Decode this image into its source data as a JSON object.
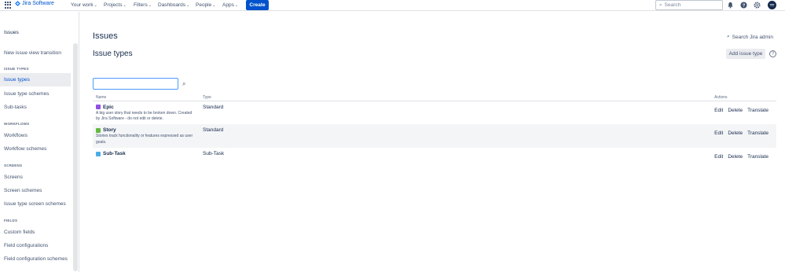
{
  "topnav": {
    "logo_text": "Jira Software",
    "items": [
      {
        "label": "Your work"
      },
      {
        "label": "Projects"
      },
      {
        "label": "Filters"
      },
      {
        "label": "Dashboards"
      },
      {
        "label": "People"
      },
      {
        "label": "Apps"
      }
    ],
    "create_label": "Create",
    "search_placeholder": "Search",
    "avatar_initials": "TT"
  },
  "sidebar": {
    "title": "Issues",
    "items": [
      {
        "label": "New issue view transition"
      },
      {
        "label": "Issue types"
      },
      {
        "label": "Issue type schemes"
      },
      {
        "label": "Sub-tasks"
      },
      {
        "label": "Workflows"
      },
      {
        "label": "Workflow schemes"
      },
      {
        "label": "Screens"
      },
      {
        "label": "Screen schemes"
      },
      {
        "label": "Issue type screen schemes"
      },
      {
        "label": "Custom fields"
      },
      {
        "label": "Field configurations"
      },
      {
        "label": "Field configuration schemes"
      }
    ],
    "sections": [
      {
        "label": "ISSUE TYPES"
      },
      {
        "label": "WORKFLOWS"
      },
      {
        "label": "SCREENS"
      },
      {
        "label": "FIELDS"
      }
    ]
  },
  "main": {
    "heading": "Issues",
    "subheading": "Issue types",
    "search_admin_label": "Search Jira admin",
    "add_button_label": "Add issue type",
    "table": {
      "headers": {
        "name": "Name",
        "type": "Type",
        "actions": "Actions"
      },
      "rows": [
        {
          "name": "Epic",
          "desc": "A big user story that needs to be broken down. Created by Jira Software - do not edit or delete.",
          "type": "Standard",
          "icon_color": "#904EE2"
        },
        {
          "name": "Story",
          "desc": "Stories track functionality or features expressed as user goals.",
          "type": "Standard",
          "icon_color": "#63BA3C"
        },
        {
          "name": "Sub-Task",
          "desc": "",
          "type": "Sub-Task",
          "icon_color": "#4BADE8"
        }
      ],
      "action_labels": {
        "edit": "Edit",
        "delete": "Delete",
        "translate": "Translate"
      }
    }
  },
  "colors": {
    "accent": "#0052CC",
    "active_bg": "#EBECF0",
    "stripe_bg": "#F4F5F7"
  }
}
